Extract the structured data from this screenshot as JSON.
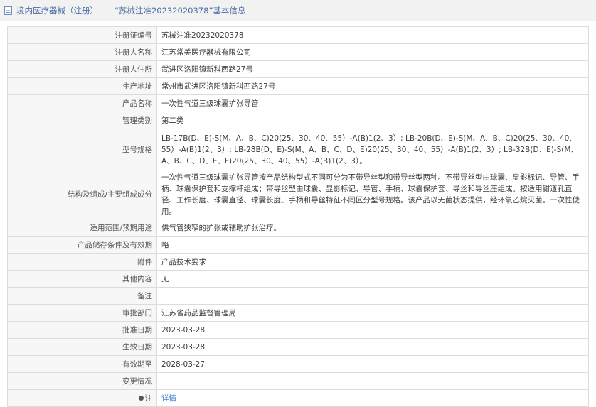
{
  "header": {
    "title": "境内医疗器械（注册）——“苏械注准20232020378”基本信息"
  },
  "rows": [
    {
      "label": "注册证编号",
      "value": "苏械注准20232020378"
    },
    {
      "label": "注册人名称",
      "value": "江苏常美医疗器械有限公司"
    },
    {
      "label": "注册人住所",
      "value": "武进区洛阳镇新科西路27号"
    },
    {
      "label": "生产地址",
      "value": "常州市武进区洛阳镇新科西路27号"
    },
    {
      "label": "产品名称",
      "value": "一次性气道三级球囊扩张导管"
    },
    {
      "label": "管理类别",
      "value": "第二类"
    },
    {
      "label": "型号规格",
      "value": "LB-17B(D、E)-S(M、A、B、C)20(25、30、40、55）-A(B)1(2、3）; LB-20B(D、E)-S(M、A、B、C)20(25、30、40、55）-A(B)1(2、3）; LB-28B(D、E)-S(M、A、B、C、D、E)20(25、30、40、55）-A(B)1(2、3）; LB-32B(D、E)-S(M、A、B、C、D、E、F)20(25、30、40、55）-A(B)1(2、3）。"
    },
    {
      "label": "结构及组成/主要组成成分",
      "value": "一次性气道三级球囊扩张导管按产品结构型式不同可分为不带导丝型和带导丝型两种。不带导丝型由球囊、显影标记、导管、手柄、球囊保护套和支撑杆组成；带导丝型由球囊、显影标记、导管、手柄、球囊保护套、导丝和导丝座组成。按适用钳道孔直径、工作长度、球囊直径、球囊长度、手柄和导丝特征不同区分型号规格。该产品以无菌状态提供，经环氧乙烷灭菌。一次性使用。"
    },
    {
      "label": "适用范围/预期用途",
      "value": "供气管狭窄的扩张或辅助扩张治疗。"
    },
    {
      "label": "产品储存条件及有效期",
      "value": "略"
    },
    {
      "label": "附件",
      "value": "产品技术要求"
    },
    {
      "label": "其他内容",
      "value": "无"
    },
    {
      "label": "备注",
      "value": ""
    },
    {
      "label": "审批部门",
      "value": "江苏省药品监督管理局"
    },
    {
      "label": "批准日期",
      "value": "2023-03-28"
    },
    {
      "label": "生效日期",
      "value": "2023-03-28"
    },
    {
      "label": "有效期至",
      "value": "2028-03-27"
    },
    {
      "label": "变更情况",
      "value": ""
    }
  ],
  "note_row": {
    "label": "注",
    "link": "详情",
    "icon": "note-icon"
  }
}
